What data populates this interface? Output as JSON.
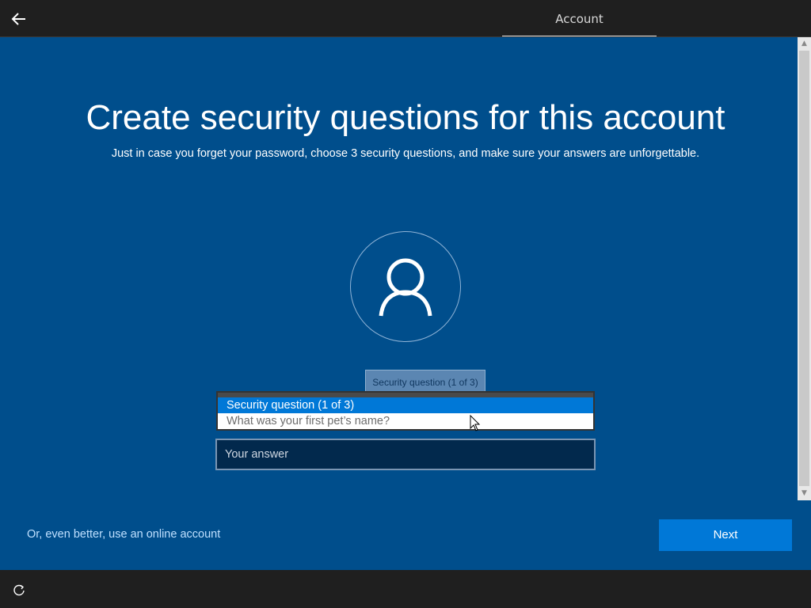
{
  "header": {
    "back_icon": "back-arrow-icon",
    "tab_label": "Account"
  },
  "main": {
    "title": "Create security questions for this account",
    "subtitle": "Just in case you forget your password, choose 3 security questions, and make sure your answers are unforgettable.",
    "avatar_icon": "user-icon",
    "tooltip": "Security question (1 of 3)",
    "dropdown": {
      "selected": "Security question (1 of 3)",
      "option": "What was your first pet’s name?"
    },
    "answer_placeholder": "Your answer",
    "online_link": "Or, even better, use an online account",
    "next_label": "Next"
  },
  "footer": {
    "ease_icon": "ease-of-access-icon"
  },
  "colors": {
    "background": "#004e8c",
    "accent": "#0078d7",
    "topbar": "#1f1f1f"
  }
}
